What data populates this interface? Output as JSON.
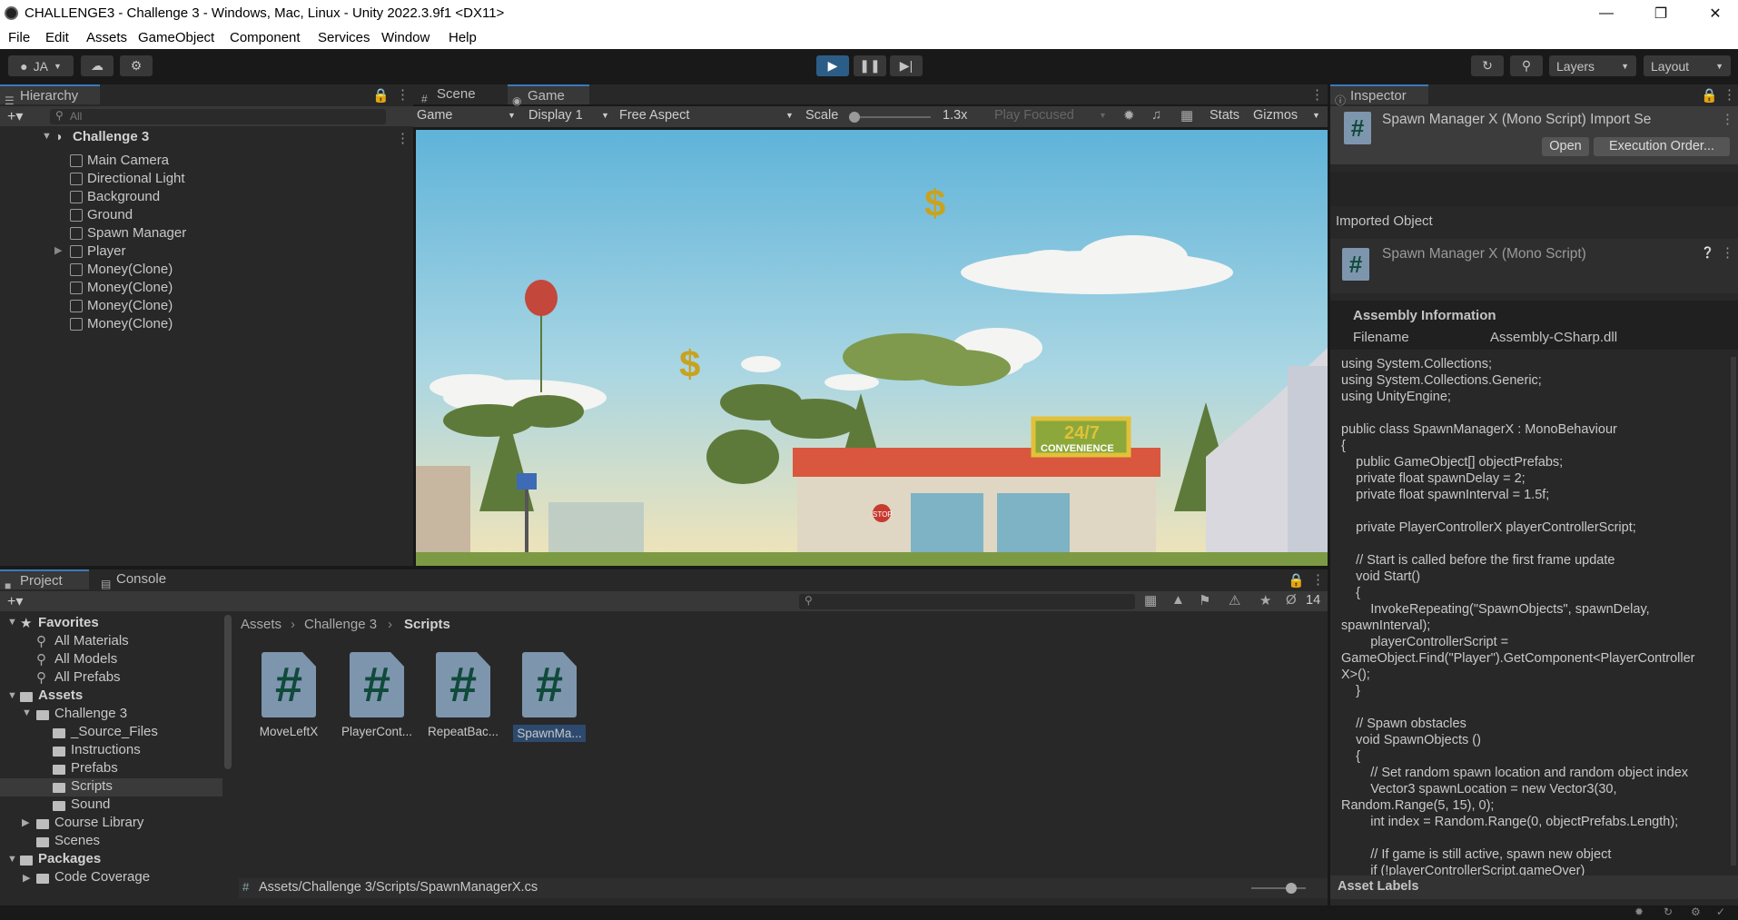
{
  "window": {
    "title": "CHALLENGE3 - Challenge 3 - Windows, Mac, Linux - Unity 2022.3.9f1 <DX11>"
  },
  "menu": [
    "File",
    "Edit",
    "Assets",
    "GameObject",
    "Component",
    "Services",
    "Window",
    "Help"
  ],
  "toolbar": {
    "account": "JA",
    "layers": "Layers",
    "layout": "Layout"
  },
  "hierarchy": {
    "tab": "Hierarchy",
    "search_placeholder": "All",
    "scene": "Challenge 3",
    "items": [
      "Main Camera",
      "Directional Light",
      "Background",
      "Ground",
      "Spawn Manager",
      "Player",
      "Money(Clone)",
      "Money(Clone)",
      "Money(Clone)",
      "Money(Clone)"
    ]
  },
  "view_tabs": {
    "scene": "Scene",
    "game": "Game"
  },
  "game_toolbar": {
    "mode": "Game",
    "display": "Display 1",
    "aspect": "Free Aspect",
    "scale_label": "Scale",
    "scale_value": "1.3x",
    "play_focused": "Play Focused",
    "stats": "Stats",
    "gizmos": "Gizmos"
  },
  "game_scene": {
    "store_sign": "24/7",
    "store_sub": "CONVENIENCE",
    "money_symbol": "$",
    "stop": "STOP"
  },
  "inspector": {
    "tab": "Inspector",
    "header_title": "Spawn Manager X (Mono Script) Import Se",
    "open_btn": "Open",
    "exec_btn": "Execution Order...",
    "imported_object": "Imported Object",
    "object_name": "Spawn Manager X (Mono Script)",
    "assembly_title": "Assembly Information",
    "filename_label": "Filename",
    "filename_value": "Assembly-CSharp.dll",
    "code": "using System.Collections;\nusing System.Collections.Generic;\nusing UnityEngine;\n\npublic class SpawnManagerX : MonoBehaviour\n{\n    public GameObject[] objectPrefabs;\n    private float spawnDelay = 2;\n    private float spawnInterval = 1.5f;\n\n    private PlayerControllerX playerControllerScript;\n\n    // Start is called before the first frame update\n    void Start()\n    {\n        InvokeRepeating(\"SpawnObjects\", spawnDelay,\nspawnInterval);\n        playerControllerScript =\nGameObject.Find(\"Player\").GetComponent<PlayerController\nX>();\n    }\n\n    // Spawn obstacles\n    void SpawnObjects ()\n    {\n        // Set random spawn location and random object index\n        Vector3 spawnLocation = new Vector3(30,\nRandom.Range(5, 15), 0);\n        int index = Random.Range(0, objectPrefabs.Length);\n\n        // If game is still active, spawn new object\n        if (!playerControllerScript.gameOver)",
    "asset_labels": "Asset Labels"
  },
  "project": {
    "tab_project": "Project",
    "tab_console": "Console",
    "hidden_count": "14",
    "favorites": "Favorites",
    "fav_items": [
      "All Materials",
      "All Models",
      "All Prefabs"
    ],
    "assets": "Assets",
    "tree": [
      {
        "label": "Challenge 3"
      },
      {
        "label": "_Source_Files"
      },
      {
        "label": "Instructions"
      },
      {
        "label": "Prefabs"
      },
      {
        "label": "Scripts"
      },
      {
        "label": "Sound"
      },
      {
        "label": "Course Library"
      },
      {
        "label": "Scenes"
      }
    ],
    "packages": "Packages",
    "packages_items": [
      "Code Coverage"
    ],
    "breadcrumb": [
      "Assets",
      "Challenge 3",
      "Scripts"
    ],
    "files": [
      "MoveLeftX",
      "PlayerCont...",
      "RepeatBac...",
      "SpawnMa..."
    ],
    "path": "Assets/Challenge 3/Scripts/SpawnManagerX.cs"
  }
}
